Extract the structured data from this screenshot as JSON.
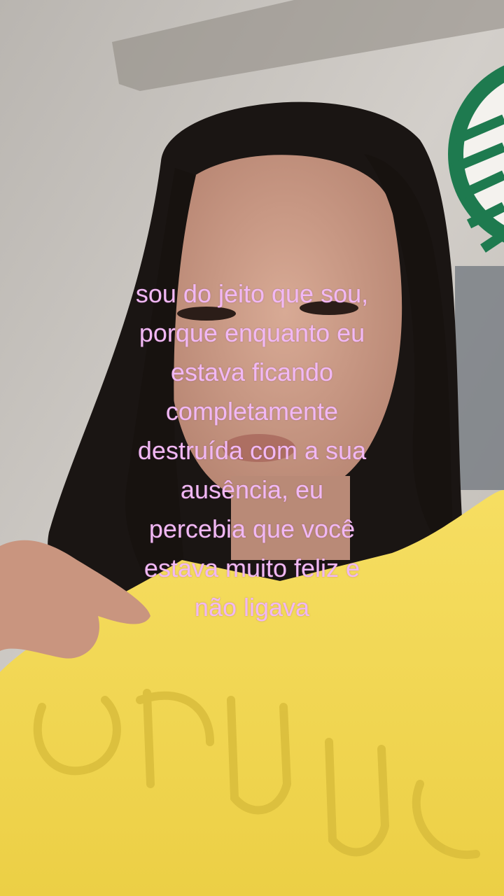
{
  "caption": {
    "lines": [
      "sou do jeito que sou,",
      "porque enquanto eu",
      "estava ficando",
      "completamente",
      "destruída com a sua",
      "ausência, eu",
      "percebia que você",
      "estava muito feliz e",
      "não ligava"
    ],
    "color": "#f1b8f4"
  },
  "scene": {
    "hoodie_color": "#f3d95a",
    "hair_color": "#1a1513",
    "skin_color": "#c99a86",
    "wall_color": "#cfcbc6",
    "logo_green": "#1e7a4f"
  }
}
